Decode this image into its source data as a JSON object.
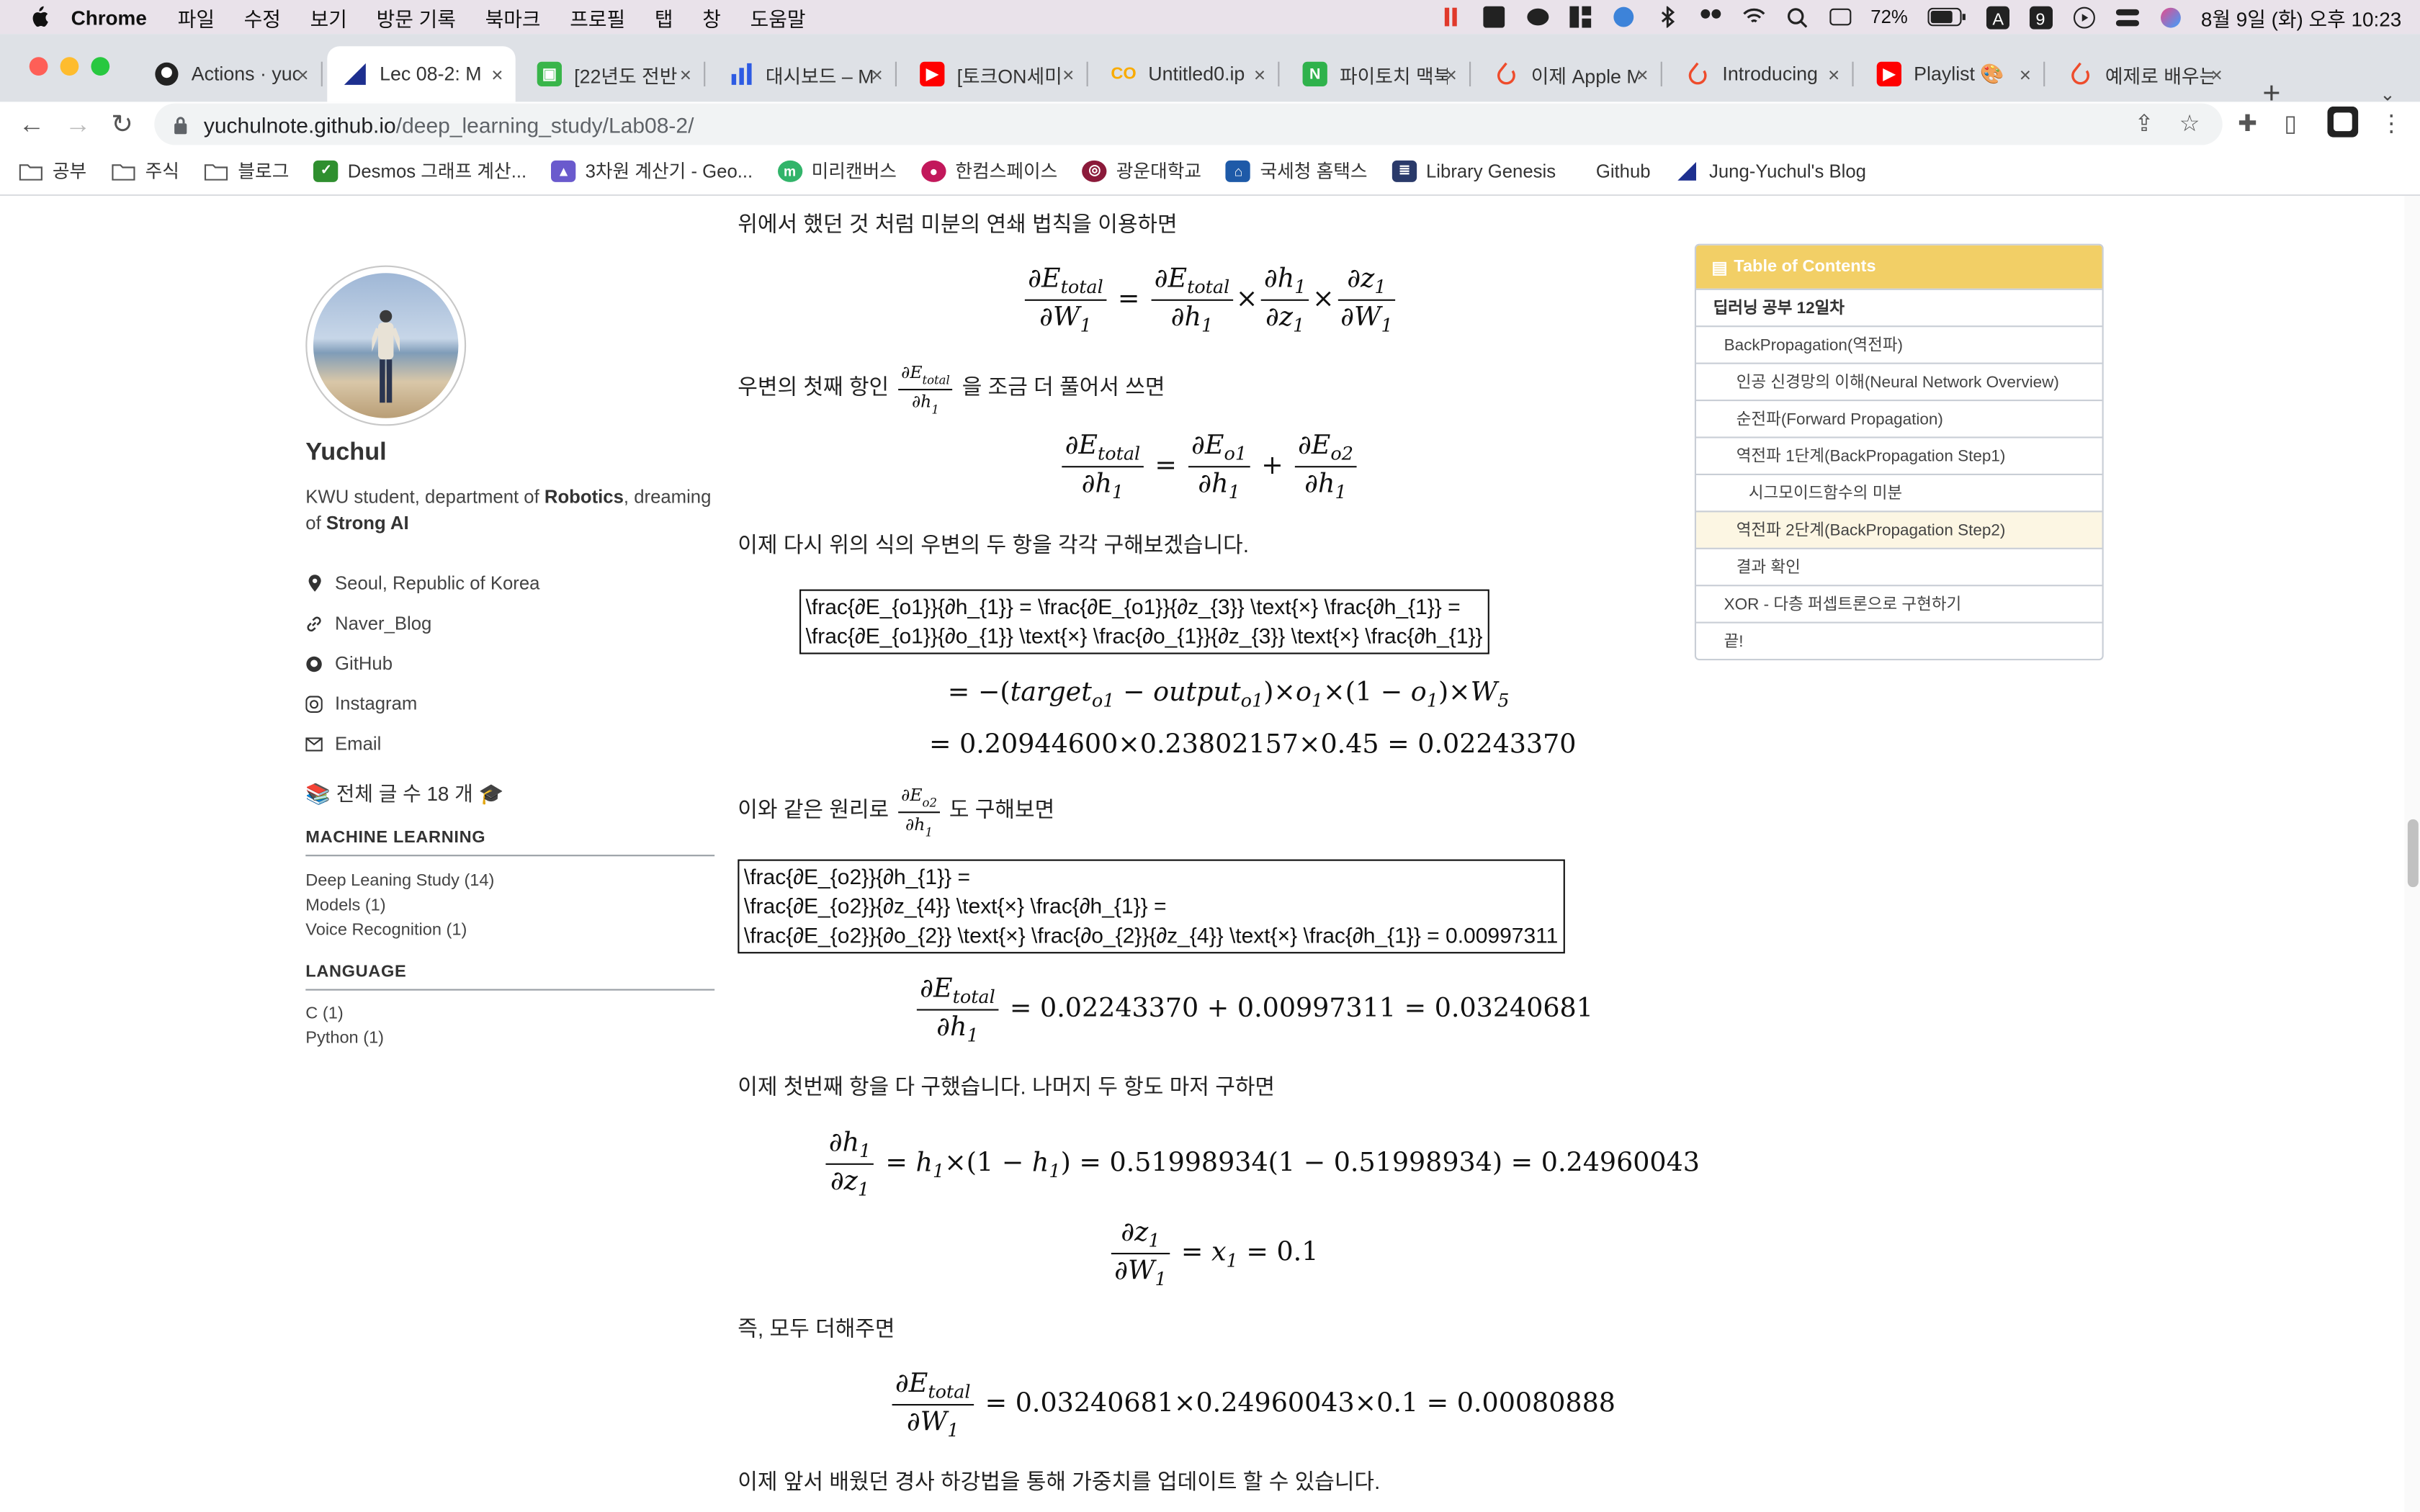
{
  "menubar": {
    "app": "Chrome",
    "items": [
      "파일",
      "수정",
      "보기",
      "방문 기록",
      "북마크",
      "프로필",
      "탭",
      "창",
      "도움말"
    ],
    "battery": "72%",
    "clock": "8월 9일 (화) 오후 10:23"
  },
  "tabs": [
    {
      "label": "Actions · yuc",
      "icon": "github-icon"
    },
    {
      "label": "Lec 08-2: M",
      "icon": "blog-icon"
    },
    {
      "label": "[22년도 전반",
      "icon": "sheet-icon"
    },
    {
      "label": "대시보드 – M",
      "icon": "dashboard-icon"
    },
    {
      "label": "[토크ON세미",
      "icon": "youtube-icon"
    },
    {
      "label": "Untitled0.ip",
      "icon": "colab-icon"
    },
    {
      "label": "파이토치 맥북",
      "icon": "notion-icon"
    },
    {
      "label": "이제 Apple M",
      "icon": "pytorch-icon"
    },
    {
      "label": "Introducing",
      "icon": "pytorch-icon"
    },
    {
      "label": "Playlist 🎨",
      "icon": "youtube-icon"
    },
    {
      "label": "예제로 배우는",
      "icon": "pytorch-icon"
    }
  ],
  "address": {
    "host": "yuchulnote.github.io",
    "path": "/deep_learning_study/Lab08-2/"
  },
  "bookmarks": [
    {
      "label": "공부",
      "icon": "folder-icon"
    },
    {
      "label": "주식",
      "icon": "folder-icon"
    },
    {
      "label": "블로그",
      "icon": "folder-icon"
    },
    {
      "label": "Desmos 그래프 계산...",
      "icon": "desmos-icon"
    },
    {
      "label": "3차원 계산기 - Geo...",
      "icon": "geogebra-icon"
    },
    {
      "label": "미리캔버스",
      "icon": "miricanvas-icon"
    },
    {
      "label": "한컴스페이스",
      "icon": "hancom-icon"
    },
    {
      "label": "광운대학교",
      "icon": "university-icon"
    },
    {
      "label": "국세청 홈택스",
      "icon": "hometax-icon"
    },
    {
      "label": "Library Genesis",
      "icon": "library-icon"
    },
    {
      "label": "Github",
      "icon": "github-icon"
    },
    {
      "label": "Jung-Yuchul's Blog",
      "icon": "blog-icon"
    }
  ],
  "sidebar": {
    "name": "Yuchul",
    "bio_1": "KWU student, department of ",
    "bio_2": "Robotics",
    "bio_3": ", dreaming",
    "bio_4": "of ",
    "bio_5": "Strong AI",
    "links": [
      {
        "label": "Seoul, Republic of Korea",
        "icon": "location-icon"
      },
      {
        "label": "Naver_Blog",
        "icon": "link-icon"
      },
      {
        "label": "GitHub",
        "icon": "github-icon"
      },
      {
        "label": "Instagram",
        "icon": "instagram-icon"
      },
      {
        "label": "Email",
        "icon": "email-icon"
      }
    ],
    "post_count": "📚 전체 글 수 18 개 🎓",
    "categories": [
      {
        "title": "MACHINE LEARNING",
        "items": [
          "Deep Leaning Study (14)",
          "Models (1)",
          "Voice Recognition (1)"
        ]
      },
      {
        "title": "LANGUAGE",
        "items": [
          "C (1)",
          "Python (1)"
        ]
      }
    ]
  },
  "content": {
    "p1": "위에서 했던 것 처럼 미분의 연쇄 법칙을 이용하면",
    "p2a": "우변의 첫째 항인",
    "p2b": "을 조금 더 풀어서 쓰면",
    "p3": "이제 다시 위의 식의 우변의 두 항을 각각 구해보겠습니다.",
    "raw1_l1": "\\frac{∂E_{o1}}{∂h_{1}} = \\frac{∂E_{o1}}{∂z_{3}} \\text{×} \\frac{∂h_{1}} =",
    "raw1_l2": "\\frac{∂E_{o1}}{∂o_{1}} \\text{×} \\frac{∂o_{1}}{∂z_{3}} \\text{×} \\frac{∂h_{1}}",
    "eq_step1_a": "= −(",
    "eq_step1_b": "target",
    "eq_step1_c": "o1",
    "eq_step1_d": " − ",
    "eq_step1_e": "output",
    "eq_step1_f": "o1",
    "eq_step1_g": ")×",
    "eq_step1_h": "o",
    "eq_step1_i": "1",
    "eq_step1_j": "×(1 − ",
    "eq_step1_k": "o",
    "eq_step1_l": "1",
    "eq_step1_m": ")×",
    "eq_step1_n": "W",
    "eq_step1_o": "5",
    "eq_step2": "= 0.20944600×0.23802157×0.45 = 0.02243370",
    "p4a": "이와 같은 원리로",
    "p4b": "도 구해보면",
    "raw2_l1": "\\frac{∂E_{o2}}{∂h_{1}} =",
    "raw2_l2": "\\frac{∂E_{o2}}{∂z_{4}} \\text{×} \\frac{∂h_{1}} =",
    "raw2_l3": "\\frac{∂E_{o2}}{∂o_{2}} \\text{×} \\frac{∂o_{2}}{∂z_{4}} \\text{×} \\frac{∂h_{1}} = 0.00997311",
    "eq_sum": "= 0.02243370 + 0.00997311 = 0.03240681",
    "p5": "이제 첫번째 항을 다 구했습니다. 나머지 두 항도 마저 구하면",
    "eq_h_a": "= ",
    "eq_h_b": "h",
    "eq_h_c": "1",
    "eq_h_d": "×(1 − ",
    "eq_h_e": "h",
    "eq_h_f": "1",
    "eq_h_g": ") = 0.51998934(1 − 0.51998934) = 0.24960043",
    "eq_z_a": "= ",
    "eq_z_b": "x",
    "eq_z_c": "1",
    "eq_z_d": " = 0.1",
    "p6": "즉, 모두 더해주면",
    "eq_final": "= 0.03240681×0.24960043×0.1 = 0.00080888",
    "p7": "이제 앞서 배웠던 경사 하강법을 통해 가중치를 업데이트 할 수 있습니다."
  },
  "toc": {
    "title": "Table of Contents",
    "items": [
      {
        "label": "딥러닝 공부 12일차",
        "level": 1
      },
      {
        "label": "BackPropagation(역전파)",
        "level": 2
      },
      {
        "label": "인공 신경망의 이해(Neural Network Overview)",
        "level": 3
      },
      {
        "label": "순전파(Forward Propagation)",
        "level": 3
      },
      {
        "label": "역전파 1단계(BackPropagation Step1)",
        "level": 3
      },
      {
        "label": "시그모이드함수의 미분",
        "level": 4
      },
      {
        "label": "역전파 2단계(BackPropagation Step2)",
        "level": 3,
        "active": true
      },
      {
        "label": "결과 확인",
        "level": 3
      },
      {
        "label": "XOR - 다층 퍼셉트론으로 구현하기",
        "level": 2
      },
      {
        "label": "끝!",
        "level": 2
      }
    ]
  },
  "colors": {
    "toc_header": "#f2cf66",
    "toc_active": "#fcf6e3",
    "menubar": "#e9e2ea",
    "tabstrip": "#dee1e6"
  }
}
